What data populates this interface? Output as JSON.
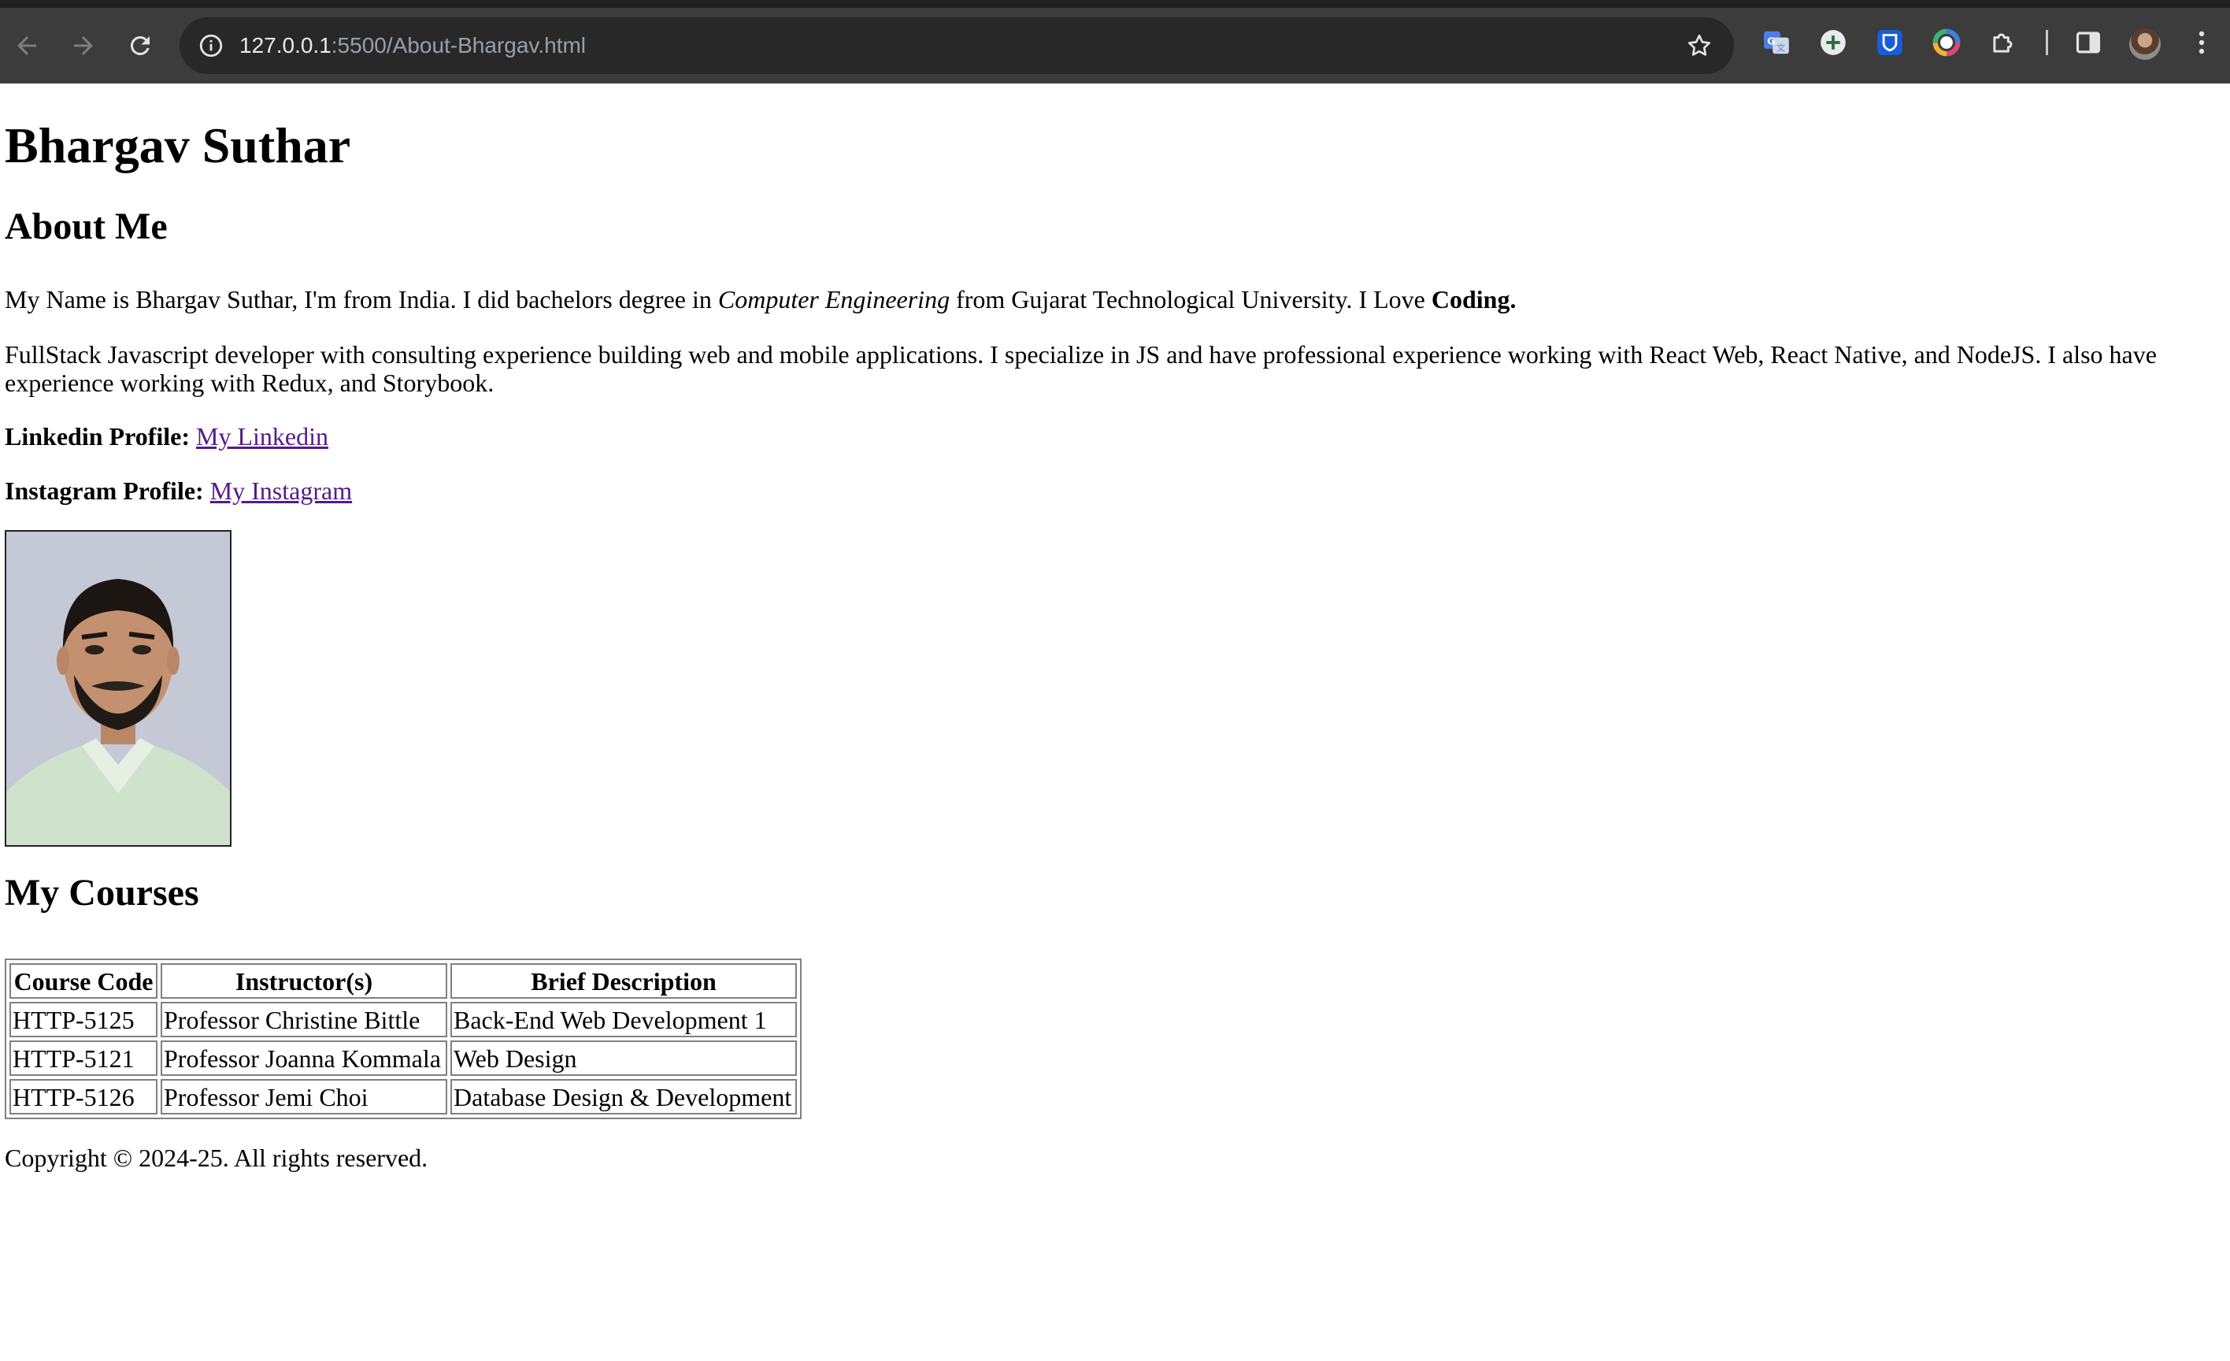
{
  "browser": {
    "url_host": "127.0.0.1",
    "url_rest": ":5500/About-Bhargav.html"
  },
  "page": {
    "name_heading": "Bhargav Suthar",
    "about_heading": "About Me",
    "about": {
      "intro_start": "My Name is Bhargav Suthar, I'm from India. I did bachelors degree in ",
      "intro_field": "Computer Engineering",
      "intro_middle": " from Gujarat Technological University. I Love ",
      "intro_love": "Coding.",
      "experience": "FullStack Javascript developer with consulting experience building web and mobile applications. I specialize in JS and have professional experience working with React Web, React Native, and NodeJS. I also have experience working with Redux, and Storybook."
    },
    "linkedin": {
      "label": "Linkedin Profile:",
      "link_text": "My Linkedin"
    },
    "instagram": {
      "label": "Instagram Profile:",
      "link_text": "My Instagram"
    },
    "courses_heading": "My Courses",
    "courses_table": {
      "headers": [
        "Course Code",
        "Instructor(s)",
        "Brief Description"
      ],
      "rows": [
        [
          "HTTP-5125",
          "Professor Christine Bittle",
          "Back-End Web Development 1"
        ],
        [
          "HTTP-5121",
          "Professor Joanna Kommala",
          "Web Design"
        ],
        [
          "HTTP-5126",
          "Professor Jemi Choi",
          "Database Design & Development"
        ]
      ]
    },
    "footer": "Copyright © 2024-25. All rights reserved."
  },
  "icons": {
    "back": "back-arrow-icon",
    "forward": "forward-arrow-icon",
    "reload": "reload-icon",
    "site_info": "info-icon",
    "bookmark": "star-icon",
    "translate": "google-translate-icon",
    "add": "plus-circle-icon",
    "password_manager": "shield-icon",
    "color_picker": "color-ring-icon",
    "extensions": "puzzle-icon",
    "side_panel": "side-panel-icon",
    "menu": "kebab-menu-icon"
  }
}
